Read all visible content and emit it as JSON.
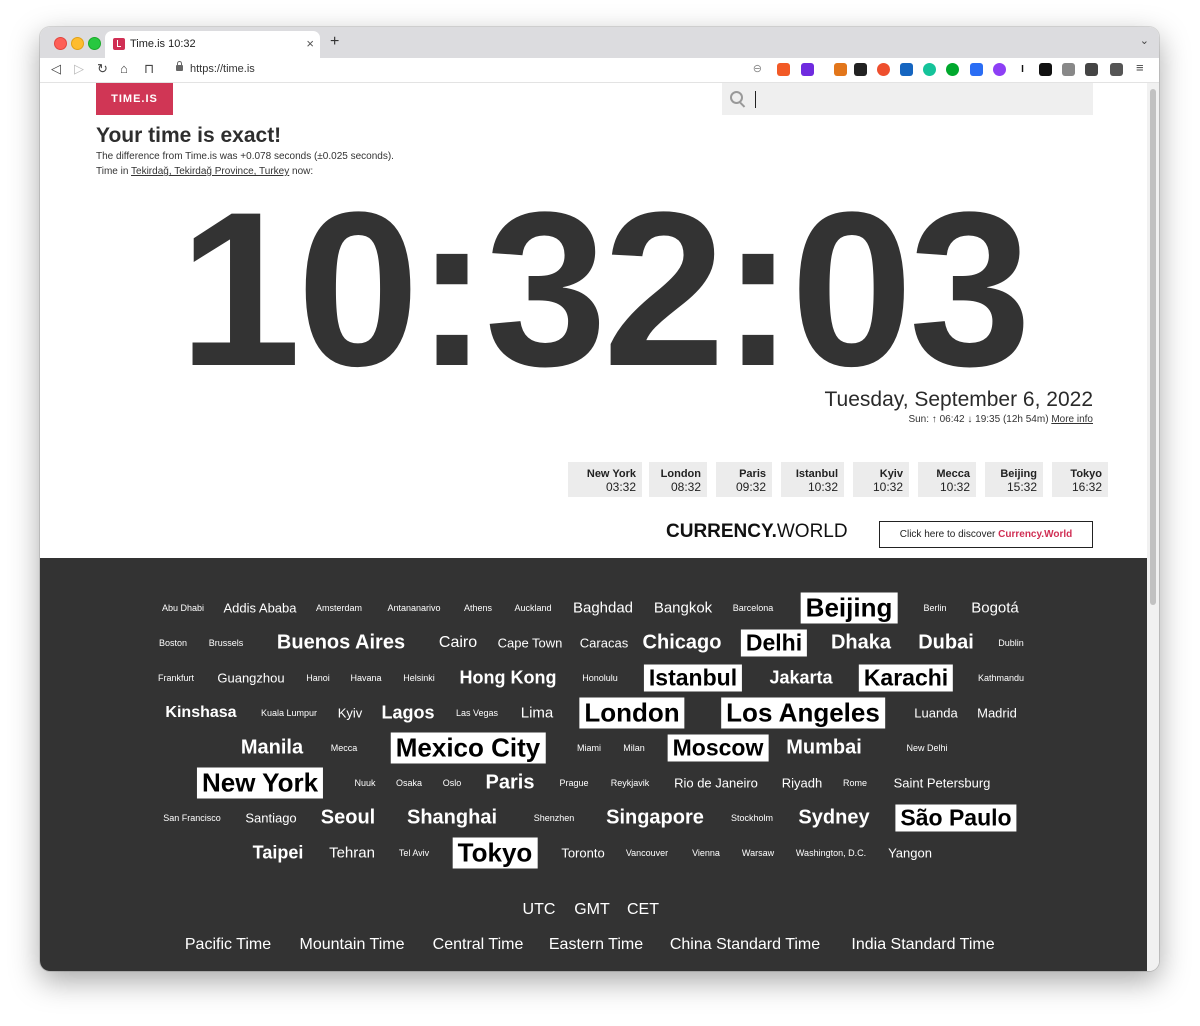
{
  "browser": {
    "tab_title": "Time.is 10:32",
    "tab_close": "×",
    "new_tab": "+",
    "tabs_menu": "⌄",
    "url": "https://time.is",
    "nav": {
      "back": "◁",
      "forward": "▷",
      "reload": "↻",
      "home": "⌂",
      "bookmark": "⊓"
    },
    "zoom_icon": "⊖",
    "menu": "≡"
  },
  "page": {
    "logo": "TIME.IS",
    "headline": "Your time is exact!",
    "difference": "The difference from Time.is was +0.078 seconds (±0.025 seconds).",
    "location_prefix": "Time in ",
    "location": "Tekirdağ, Tekirdağ Province, Turkey",
    "location_suffix": " now:",
    "clock": "10:32:03",
    "date": "Tuesday, September 6, 2022",
    "sun_info": "Sun: ↑ 06:42 ↓ 19:35 (12h 54m) ",
    "more_info": "More info",
    "cities": [
      {
        "name": "New York",
        "time": "03:32"
      },
      {
        "name": "London",
        "time": "08:32"
      },
      {
        "name": "Paris",
        "time": "09:32"
      },
      {
        "name": "Istanbul",
        "time": "10:32"
      },
      {
        "name": "Kyiv",
        "time": "10:32"
      },
      {
        "name": "Mecca",
        "time": "10:32"
      },
      {
        "name": "Beijing",
        "time": "15:32"
      },
      {
        "name": "Tokyo",
        "time": "16:32"
      }
    ],
    "currency_logo_bold": "CURRENCY.",
    "currency_logo_rest": "WORLD",
    "currency_btn_prefix": "Click here to discover ",
    "currency_btn_link": "Currency.World"
  },
  "world_cities": [
    "Abu Dhabi",
    "Addis Ababa",
    "Amsterdam",
    "Antananarivo",
    "Athens",
    "Auckland",
    "Baghdad",
    "Bangkok",
    "Barcelona",
    "Beijing",
    "Berlin",
    "Bogotá",
    "Boston",
    "Brussels",
    "Buenos Aires",
    "Cairo",
    "Cape Town",
    "Caracas",
    "Chicago",
    "Delhi",
    "Dhaka",
    "Dubai",
    "Dublin",
    "Frankfurt",
    "Guangzhou",
    "Hanoi",
    "Havana",
    "Helsinki",
    "Hong Kong",
    "Honolulu",
    "Istanbul",
    "Jakarta",
    "Karachi",
    "Kathmandu",
    "Kinshasa",
    "Kuala Lumpur",
    "Kyiv",
    "Lagos",
    "Las Vegas",
    "Lima",
    "London",
    "Los Angeles",
    "Luanda",
    "Madrid",
    "Manila",
    "Mecca",
    "Mexico City",
    "Miami",
    "Milan",
    "Moscow",
    "Mumbai",
    "New Delhi",
    "New York",
    "Nuuk",
    "Osaka",
    "Oslo",
    "Paris",
    "Prague",
    "Reykjavik",
    "Rio de Janeiro",
    "Riyadh",
    "Rome",
    "Saint Petersburg",
    "San Francisco",
    "Santiago",
    "Seoul",
    "Shanghai",
    "Shenzhen",
    "Singapore",
    "Stockholm",
    "Sydney",
    "São Paulo",
    "Taipei",
    "Tehran",
    "Tel Aviv",
    "Tokyo",
    "Toronto",
    "Vancouver",
    "Vienna",
    "Warsaw",
    "Washington, D.C.",
    "Yangon"
  ],
  "timezones_row1": [
    "UTC",
    "GMT",
    "CET"
  ],
  "timezones_row2": [
    "Pacific Time",
    "Mountain Time",
    "Central Time",
    "Eastern Time",
    "China Standard Time",
    "India Standard Time"
  ]
}
